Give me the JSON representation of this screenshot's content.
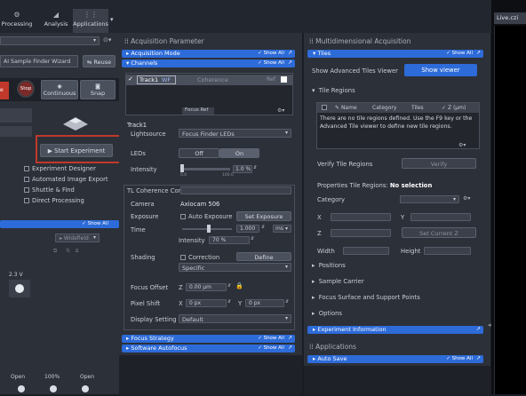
{
  "top_tabs": [
    {
      "label": "Processing",
      "icon": "gear-icon"
    },
    {
      "label": "Analysis",
      "icon": "chart-icon"
    },
    {
      "label": "Applications",
      "icon": "apps-icon"
    }
  ],
  "left": {
    "sample_finder": "AI Sample Finder Wizard",
    "reuse": "Reuse",
    "stop": "Stop",
    "continuous": "Continuous",
    "snap": "Snap",
    "start_experiment": "Start Experiment",
    "options": [
      {
        "label": "Experiment Designer",
        "checked": false
      },
      {
        "label": "Automated Image Export",
        "checked": false
      },
      {
        "label": "Shuttle & Find",
        "checked": false
      },
      {
        "label": "Direct Processing",
        "checked": false
      }
    ],
    "show_all": "Show All",
    "widefield": "Widefield",
    "voltage": "2.3 V",
    "lamp_labels": [
      "Open",
      "100%",
      "Open"
    ],
    "highlight_color": "#c0392b"
  },
  "acq": {
    "title": "Acquisition Parameter",
    "sections": [
      {
        "label": "Acquisition Mode",
        "show_all": "Show All"
      },
      {
        "label": "Channels",
        "show_all": "Show All"
      }
    ],
    "track_name": "Track1",
    "track_type": "WF",
    "track_mode": "Coherence",
    "track_ref": "Ref",
    "focus_ref": "Focus Ref",
    "track_heading": "Track1",
    "lightsource_label": "Lightsource",
    "lightsource_value": "Focus Finder LEDs",
    "leds_label": "LEDs",
    "leds_off": "Off",
    "leds_on": "On",
    "intensity_label": "Intensity",
    "intensity_value": "1.0 %",
    "intensity_ticks": [
      "0.0",
      "100.0"
    ],
    "tl_coherence": "TL Coherence Con...",
    "camera_label": "Camera",
    "camera_value": "Axiocam 506",
    "exposure_label": "Exposure",
    "auto_exposure": "Auto Exposure",
    "set_exposure": "Set Exposure",
    "time_label": "Time",
    "time_value": "1.000",
    "time_unit": "ms",
    "intensity2_label": "Intensity",
    "intensity2_value": "70 %",
    "shading_label": "Shading",
    "correction": "Correction",
    "define": "Define",
    "specific": "Specific",
    "focus_offset_label": "Focus Offset",
    "focus_axis": "Z",
    "focus_offset_value": "0.00 µm",
    "pixel_shift_label": "Pixel Shift",
    "px_x": "X",
    "px_x_value": "0 px",
    "px_y": "Y",
    "px_y_value": "0 px",
    "display_setting_label": "Display Setting",
    "display_setting_value": "Default",
    "bottom_sections": [
      {
        "label": "Focus Strategy",
        "show_all": "Show All"
      },
      {
        "label": "Software Autofocus",
        "show_all": "Show All"
      }
    ]
  },
  "multi": {
    "title": "Multidimensional Acquisition",
    "tiles_label": "Tiles",
    "tiles_show_all": "Show All",
    "show_advanced": "Show Advanced Tiles Viewer",
    "show_viewer": "Show viewer",
    "tile_regions": "Tile Regions",
    "columns": [
      "Name",
      "Category",
      "Tiles",
      "Z (µm)"
    ],
    "empty_message": "There are no tile regions defined. Use the F9 key or the Advanced Tile viewer to define new tile regions.",
    "verify_label": "Verify Tile Regions",
    "verify_btn": "Verify",
    "properties_label": "Properties Tile Regions:",
    "properties_value": "No selection",
    "category": "Category",
    "x": "X",
    "y": "Y",
    "z": "Z",
    "set_current_z": "Set Current Z",
    "width": "Width",
    "height": "Height",
    "collapsed": [
      "Positions",
      "Sample Carrier",
      "Focus Surface and Support Points",
      "Options"
    ],
    "experiment_info": "Experiment Information",
    "applications": "Applications",
    "auto_save": "Auto Save",
    "auto_save_show_all": "Show All"
  },
  "right": {
    "tab_label": "Live.czi"
  }
}
